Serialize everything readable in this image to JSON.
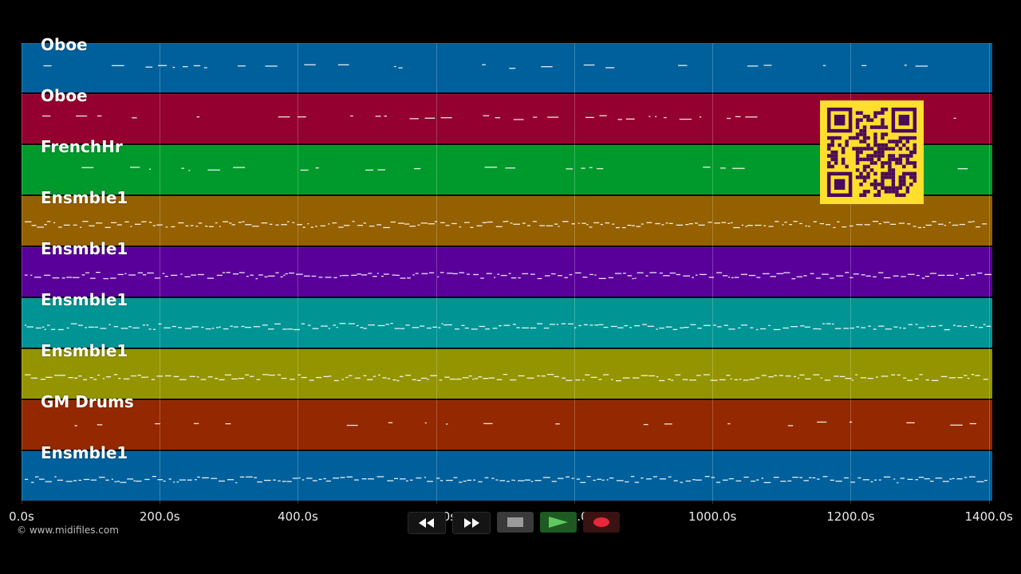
{
  "tracks": [
    {
      "name": "Oboe",
      "color": "#00609b",
      "density": 0.45,
      "style": "sparse"
    },
    {
      "name": "Oboe",
      "color": "#94002f",
      "density": 0.45,
      "style": "sparse"
    },
    {
      "name": "FrenchHr",
      "color": "#009a2c",
      "density": 0.35,
      "style": "sparse"
    },
    {
      "name": "Ensmble1",
      "color": "#946000",
      "density": 1.0,
      "style": "dense"
    },
    {
      "name": "Ensmble1",
      "color": "#5a009a",
      "density": 1.0,
      "style": "dense"
    },
    {
      "name": "Ensmble1",
      "color": "#009494",
      "density": 0.9,
      "style": "dense"
    },
    {
      "name": "Ensmble1",
      "color": "#949400",
      "density": 0.9,
      "style": "dense"
    },
    {
      "name": "GM Drums",
      "color": "#942800",
      "density": 0.35,
      "style": "sparse"
    },
    {
      "name": "Ensmble1",
      "color": "#00609b",
      "density": 0.9,
      "style": "dense"
    }
  ],
  "timeline": {
    "ticks": [
      "0.0s",
      "200.0s",
      "400.0s",
      "600.0s",
      "800.0s",
      "1000.0s",
      "1200.0s",
      "1400.0s"
    ],
    "tick_values": [
      0,
      200,
      400,
      600,
      800,
      1000,
      1200,
      1400
    ],
    "range": [
      0,
      1405
    ]
  },
  "copyright": "© www.midifiles.com",
  "transport": {
    "rewind_icon": "rewind-icon",
    "fast_forward_icon": "fast-forward-icon",
    "stop_icon": "stop-icon",
    "play_icon": "play-icon",
    "record_icon": "record-icon"
  },
  "qr_code": {
    "color": "#ffde2e",
    "module_color": "#4a0a5a"
  }
}
